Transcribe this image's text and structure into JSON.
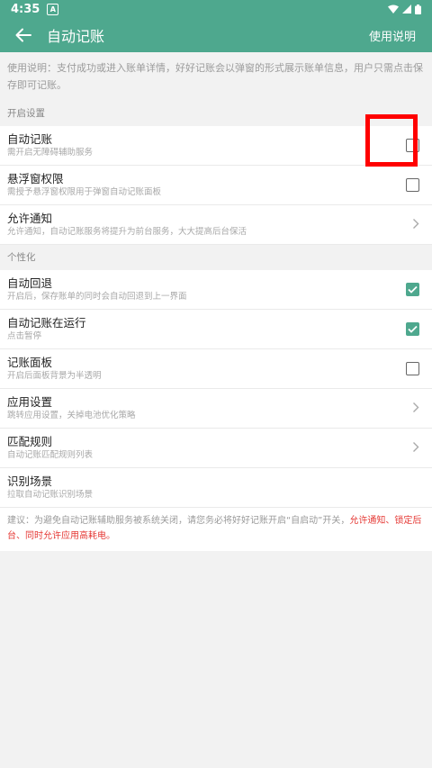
{
  "status": {
    "time": "4:35",
    "notif": "A"
  },
  "toolbar": {
    "title": "自动记账",
    "help": "使用说明"
  },
  "description": "使用说明：支付成功或进入账单详情，好好记账会以弹窗的形式展示账单信息，用户只需点击保存即可记账。",
  "sections": [
    {
      "header": "开启设置",
      "items": [
        {
          "label": "自动记账",
          "sub": "需开启无障碍辅助服务",
          "control": "checkbox",
          "checked": false
        },
        {
          "label": "悬浮窗权限",
          "sub": "需授予悬浮窗权限用于弹窗自动记账面板",
          "control": "checkbox",
          "checked": false
        },
        {
          "label": "允许通知",
          "sub": "允许通知，自动记账服务将提升为前台服务，大大提高后台保活",
          "control": "chevron"
        }
      ]
    },
    {
      "header": "个性化",
      "items": [
        {
          "label": "自动回退",
          "sub": "开启后，保存账单的同时会自动回退到上一界面",
          "control": "checkbox",
          "checked": true
        },
        {
          "label": "自动记账在运行",
          "sub": "点击暂停",
          "control": "checkbox",
          "checked": true
        },
        {
          "label": "记账面板",
          "sub": "开启后面板背景为半透明",
          "control": "checkbox",
          "checked": false
        },
        {
          "label": "应用设置",
          "sub": "跳转应用设置，关掉电池优化策略",
          "control": "chevron"
        },
        {
          "label": "匹配规则",
          "sub": "自动记账匹配规则列表",
          "control": "chevron"
        },
        {
          "label": "识别场景",
          "sub": "拉取自动记账识别场景",
          "control": "none"
        }
      ]
    }
  ],
  "note": {
    "normal": "建议：为避免自动记账辅助服务被系统关闭，请您务必将好好记账开启“自启动”开关，",
    "red": "允许通知、锁定后台、同时允许应用高耗电。"
  },
  "colors": {
    "accent": "#4ea88e",
    "warning": "#e53935",
    "highlight": "#ff0000"
  }
}
